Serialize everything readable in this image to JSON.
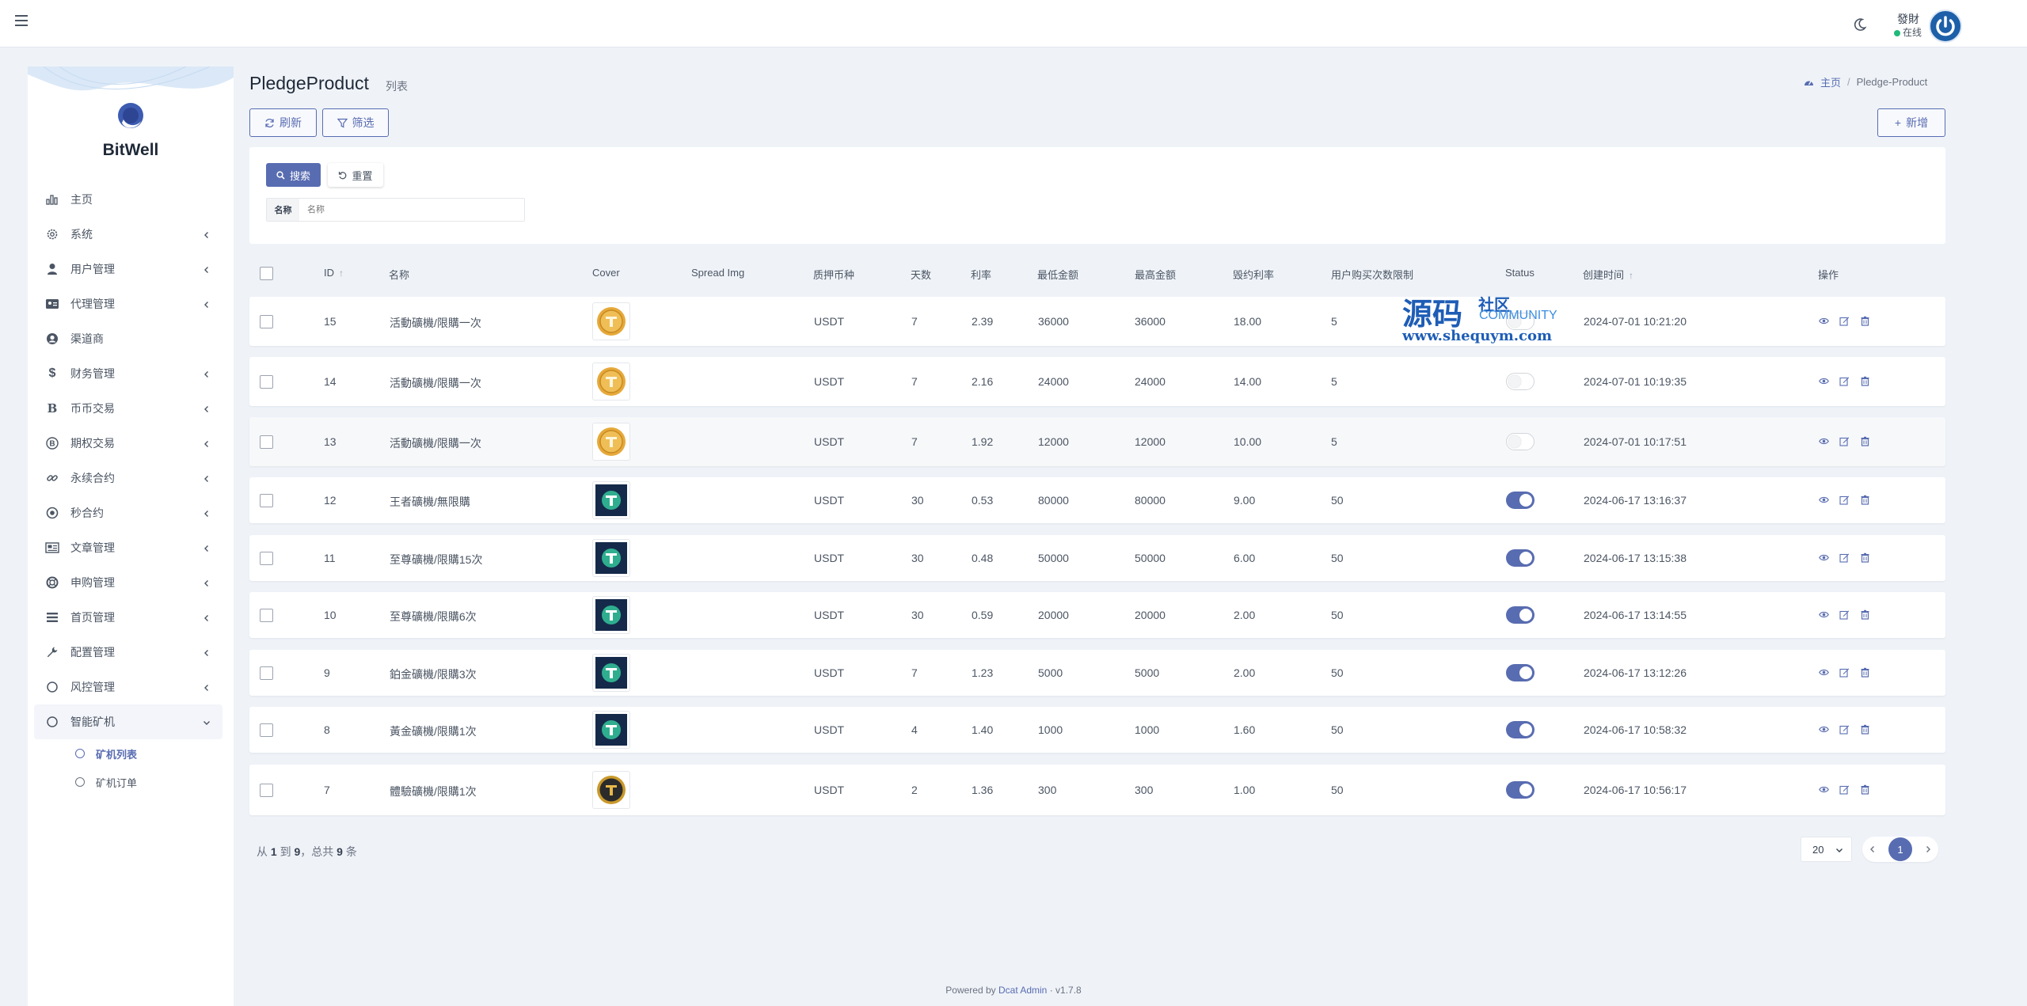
{
  "header": {
    "user_name": "發財",
    "user_status": "在线"
  },
  "brand": {
    "name": "BitWell"
  },
  "sidebar": {
    "items": [
      {
        "label": "主页",
        "icon": "bar-chart-icon",
        "has_children": false
      },
      {
        "label": "系统",
        "icon": "gear-icon",
        "has_children": true
      },
      {
        "label": "用户管理",
        "icon": "user-tie-icon",
        "has_children": true
      },
      {
        "label": "代理管理",
        "icon": "id-card-icon",
        "has_children": true
      },
      {
        "label": "渠道商",
        "icon": "user-circle-icon",
        "has_children": false
      },
      {
        "label": "财务管理",
        "icon": "dollar-icon",
        "has_children": true
      },
      {
        "label": "币币交易",
        "icon": "bitcoin-b-icon",
        "has_children": true
      },
      {
        "label": "期权交易",
        "icon": "bitcoin-coin-icon",
        "has_children": true
      },
      {
        "label": "永续合约",
        "icon": "link-icon",
        "has_children": true
      },
      {
        "label": "秒合约",
        "icon": "dot-circle-icon",
        "has_children": true
      },
      {
        "label": "文章管理",
        "icon": "newspaper-icon",
        "has_children": true
      },
      {
        "label": "申购管理",
        "icon": "life-ring-icon",
        "has_children": true
      },
      {
        "label": "首页管理",
        "icon": "list-icon",
        "has_children": true
      },
      {
        "label": "配置管理",
        "icon": "wrench-icon",
        "has_children": true
      },
      {
        "label": "风控管理",
        "icon": "circle-icon",
        "has_children": true
      },
      {
        "label": "智能矿机",
        "icon": "circle-icon",
        "has_children": true,
        "open": true
      }
    ],
    "sub_items": [
      {
        "label": "矿机列表",
        "active": true
      },
      {
        "label": "矿机订单",
        "active": false
      }
    ]
  },
  "page": {
    "title": "PledgeProduct",
    "subtitle": "列表",
    "breadcrumb_home": "主页",
    "breadcrumb_current": "Pledge-Product"
  },
  "toolbar": {
    "refresh_label": "刷新",
    "filter_label": "筛选",
    "new_label": "新增"
  },
  "filter": {
    "search_label": "搜索",
    "reset_label": "重置",
    "name_label": "名称",
    "name_placeholder": "名称",
    "name_value": ""
  },
  "table": {
    "columns": [
      "ID",
      "名称",
      "Cover",
      "Spread Img",
      "质押币种",
      "天数",
      "利率",
      "最低金额",
      "最高金额",
      "毁约利率",
      "用户购买次数限制",
      "Status",
      "创建时间",
      "操作"
    ],
    "rows": [
      {
        "id": "15",
        "name": "活動礦機/限購一次",
        "cover": "gold-tether-coin",
        "coin": "USDT",
        "days": "7",
        "rate": "2.39",
        "min": "36000",
        "max": "36000",
        "breach": "18.00",
        "limit": "5",
        "status": "off",
        "created": "2024-07-01 10:21:20"
      },
      {
        "id": "14",
        "name": "活動礦機/限購一次",
        "cover": "gold-tether-coin",
        "coin": "USDT",
        "days": "7",
        "rate": "2.16",
        "min": "24000",
        "max": "24000",
        "breach": "14.00",
        "limit": "5",
        "status": "off",
        "created": "2024-07-01 10:19:35"
      },
      {
        "id": "13",
        "name": "活動礦機/限購一次",
        "cover": "gold-tether-coin",
        "coin": "USDT",
        "days": "7",
        "rate": "1.92",
        "min": "12000",
        "max": "12000",
        "breach": "10.00",
        "limit": "5",
        "status": "off",
        "created": "2024-07-01 10:17:51"
      },
      {
        "id": "12",
        "name": "王者礦機/無限購",
        "cover": "teal-tether-coin",
        "coin": "USDT",
        "days": "30",
        "rate": "0.53",
        "min": "80000",
        "max": "80000",
        "breach": "9.00",
        "limit": "50",
        "status": "on",
        "created": "2024-06-17 13:16:37"
      },
      {
        "id": "11",
        "name": "至尊礦機/限購15次",
        "cover": "teal-tether-coin",
        "coin": "USDT",
        "days": "30",
        "rate": "0.48",
        "min": "50000",
        "max": "50000",
        "breach": "6.00",
        "limit": "50",
        "status": "on",
        "created": "2024-06-17 13:15:38"
      },
      {
        "id": "10",
        "name": "至尊礦機/限購6次",
        "cover": "teal-tether-coin",
        "coin": "USDT",
        "days": "30",
        "rate": "0.59",
        "min": "20000",
        "max": "20000",
        "breach": "2.00",
        "limit": "50",
        "status": "on",
        "created": "2024-06-17 13:14:55"
      },
      {
        "id": "9",
        "name": "鉑金礦機/限購3次",
        "cover": "teal-tether-coin",
        "coin": "USDT",
        "days": "7",
        "rate": "1.23",
        "min": "5000",
        "max": "5000",
        "breach": "2.00",
        "limit": "50",
        "status": "on",
        "created": "2024-06-17 13:12:26"
      },
      {
        "id": "8",
        "name": "黃金礦機/限購1次",
        "cover": "teal-tether-coin",
        "coin": "USDT",
        "days": "4",
        "rate": "1.40",
        "min": "1000",
        "max": "1000",
        "breach": "1.60",
        "limit": "50",
        "status": "on",
        "created": "2024-06-17 10:58:32"
      },
      {
        "id": "7",
        "name": "體驗礦機/限購1次",
        "cover": "dark-gold-tether-coin",
        "coin": "USDT",
        "days": "2",
        "rate": "1.36",
        "min": "300",
        "max": "300",
        "breach": "1.00",
        "limit": "50",
        "status": "on",
        "created": "2024-06-17 10:56:17"
      }
    ]
  },
  "watermark": {
    "big": "源码",
    "small": "社区",
    "community": "COMMUNITY",
    "url": "www.shequym.com"
  },
  "pagination": {
    "summary_prefix": "从",
    "from": "1",
    "to_word": "到",
    "to": "9",
    "total_word": "，总共",
    "total": "9",
    "unit": "条",
    "per_page": "20",
    "current_page": "1"
  },
  "footer": {
    "prefix": "Powered by",
    "link": "Dcat Admin",
    "version": "· v1.7.8"
  },
  "colors": {
    "accent": "#586cb1",
    "online": "#21b978",
    "background": "#eff3f8"
  }
}
